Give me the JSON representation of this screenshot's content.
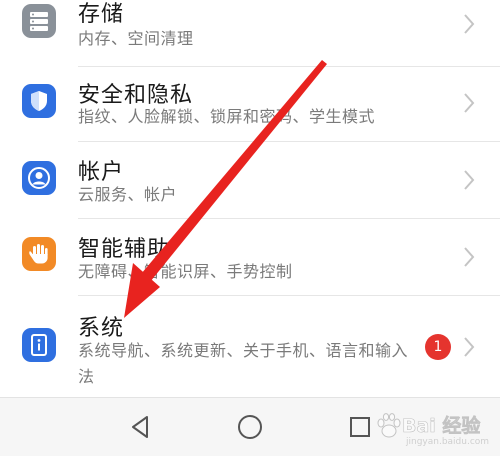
{
  "settings": {
    "items": [
      {
        "title": "存储",
        "subtitle": "内存、空间清理",
        "icon": "storage-icon",
        "icon_color": "#8a9199"
      },
      {
        "title": "安全和隐私",
        "subtitle": "指纹、人脸解锁、锁屏和密码、学生模式",
        "icon": "shield-icon",
        "icon_color": "#2f6fe0"
      },
      {
        "title": "帐户",
        "subtitle": "云服务、帐户",
        "icon": "account-icon",
        "icon_color": "#2f6fe0"
      },
      {
        "title": "智能辅助",
        "subtitle": "无障碍、智能识屏、手势控制",
        "icon": "hand-icon",
        "icon_color": "#f28a26"
      },
      {
        "title": "系统",
        "subtitle": "系统导航、系统更新、关于手机、语言和输入法",
        "icon": "system-info-icon",
        "icon_color": "#2f6fe0",
        "badge": "1"
      }
    ]
  },
  "navbar": {
    "buttons": [
      {
        "icon": "back-triangle-icon"
      },
      {
        "icon": "home-circle-icon"
      },
      {
        "icon": "recents-square-icon"
      }
    ]
  },
  "watermark": {
    "text": "Bai 经验",
    "sub": "jingyan.baidu.com"
  },
  "colors": {
    "arrow": "#e8231f",
    "badge": "#e5342e"
  }
}
